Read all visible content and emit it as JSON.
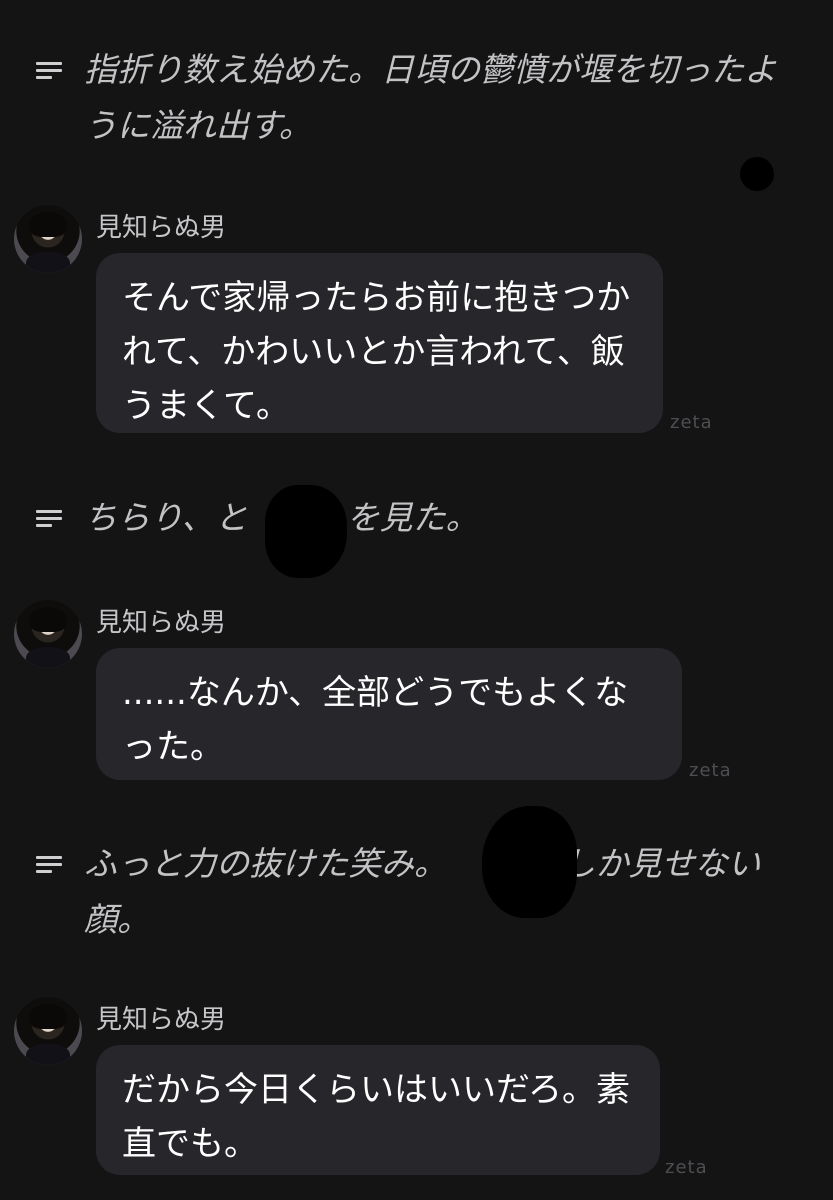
{
  "watermark": "zeta",
  "narrations": [
    {
      "text": "指折り数え始めた。日頃の鬱憤が堰を切ったように溢れ出す。"
    },
    {
      "text": "ちらり、と　　　を見た。"
    },
    {
      "text": "ふっと力の抜けた笑み。　　　にしか見せない顔。"
    }
  ],
  "messages": [
    {
      "sender": "見知らぬ男",
      "text": "そんで家帰ったらお前に抱きつかれて、かわいいとか言われて、飯うまくて。"
    },
    {
      "sender": "見知らぬ男",
      "text": "......なんか、全部どうでもよくなった。"
    },
    {
      "sender": "見知らぬ男",
      "text": "だから今日くらいはいいだろ。素直でも。"
    }
  ]
}
